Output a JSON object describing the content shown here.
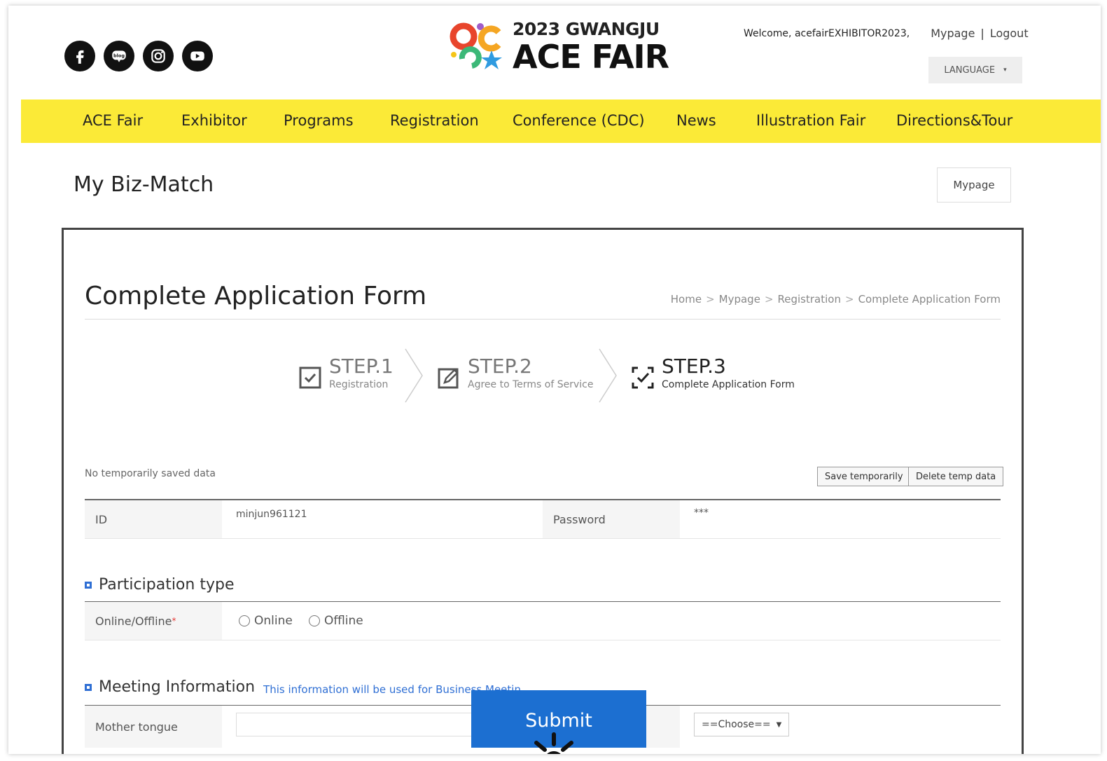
{
  "header": {
    "socials": [
      {
        "icon": "facebook-icon",
        "glyph": "f"
      },
      {
        "icon": "blog-icon",
        "glyph": "blog"
      },
      {
        "icon": "instagram-icon",
        "glyph": "ig"
      },
      {
        "icon": "youtube-icon",
        "glyph": "yt"
      }
    ],
    "logo": {
      "year": "2023 GWANGJU",
      "name": "ACE FAIR"
    },
    "welcome": "Welcome, acefairEXHIBITOR2023,",
    "mypage_link": "Mypage",
    "separator": "|",
    "logout_link": "Logout",
    "language_label": "LANGUAGE",
    "language_caret": "▾"
  },
  "nav": {
    "items": [
      "ACE Fair",
      "Exhibitor",
      "Programs",
      "Registration",
      "Conference (CDC)",
      "News",
      "Illustration Fair",
      "Directions&Tour"
    ]
  },
  "page": {
    "title": "My Biz-Match",
    "mypage_button": "Mypage"
  },
  "form": {
    "title": "Complete Application Form",
    "breadcrumb": [
      "Home",
      "Mypage",
      "Registration",
      "Complete Application Form"
    ],
    "breadcrumb_sep": ">",
    "steps": [
      {
        "num": "STEP.1",
        "sub": "Registration",
        "icon": "checkbox-icon",
        "active": false
      },
      {
        "num": "STEP.2",
        "sub": "Agree to Terms of Service",
        "icon": "edit-icon",
        "active": false
      },
      {
        "num": "STEP.3",
        "sub": "Complete Application Form",
        "icon": "complete-check-icon",
        "active": true
      }
    ],
    "temp_note": "No temporarily saved data",
    "save_temp_button": "Save temporarily",
    "delete_temp_button": "Delete temp data",
    "account": {
      "id_label": "ID",
      "id_value": "minjun961121",
      "password_label": "Password",
      "password_value": "***"
    },
    "participation": {
      "section_title": "Participation type",
      "label": "Online/Offline",
      "required_mark": "*",
      "options": [
        "Online",
        "Offline"
      ]
    },
    "meeting": {
      "section_title": "Meeting Information",
      "note": "This information will be used for Business Meetin",
      "mother_tongue_label": "Mother tongue",
      "mother_tongue_value": "",
      "select_value": "==Choose=="
    },
    "submit_label": "Submit"
  },
  "colors": {
    "nav_bg": "#fbea37",
    "accent_blue": "#1c6fd1",
    "section_blue": "#2f6fd4"
  }
}
